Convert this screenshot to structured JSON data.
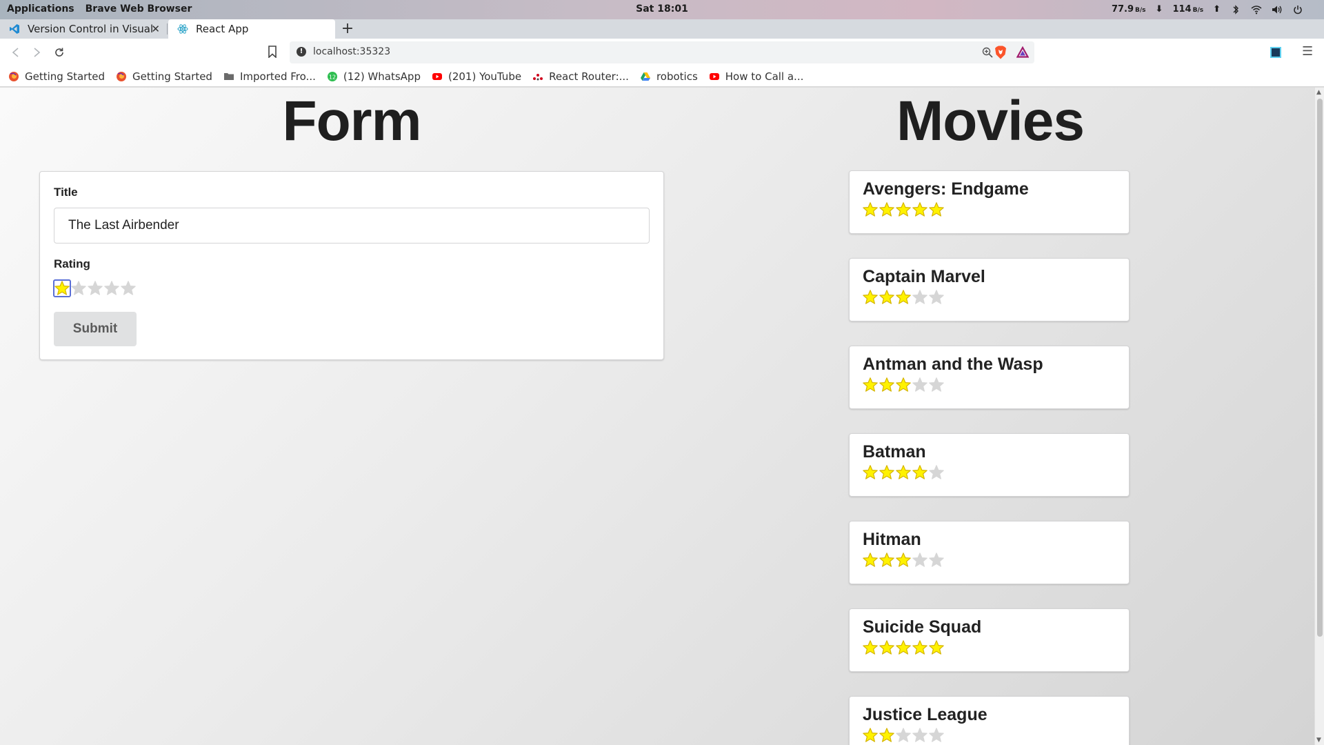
{
  "os": {
    "apps_label": "Applications",
    "active_app": "Brave Web Browser",
    "clock": "Sat 18:01",
    "net_down": "77.9",
    "net_down_unit": "B/s",
    "net_up": "114",
    "net_up_unit": "B/s"
  },
  "tabs": [
    {
      "label": "Version Control in Visual St",
      "icon": "vscode-icon",
      "active": false
    },
    {
      "label": "React App",
      "icon": "react-icon",
      "active": true
    }
  ],
  "toolbar": {
    "url": "localhost:35323"
  },
  "bookmarks": [
    {
      "label": "Getting Started",
      "icon": "firefox-icon"
    },
    {
      "label": "Getting Started",
      "icon": "firefox-icon"
    },
    {
      "label": "Imported Fro...",
      "icon": "folder-icon"
    },
    {
      "label": "(12) WhatsApp",
      "icon": "whatsapp-icon"
    },
    {
      "label": "(201) YouTube",
      "icon": "youtube-icon"
    },
    {
      "label": "React Router:...",
      "icon": "react-router-icon"
    },
    {
      "label": "robotics",
      "icon": "drive-icon"
    },
    {
      "label": "How to Call a...",
      "icon": "youtube-icon"
    }
  ],
  "form": {
    "heading": "Form",
    "title_label": "Title",
    "title_value": "The Last Airbender",
    "rating_label": "Rating",
    "rating_value": 1,
    "rating_max": 5,
    "submit_label": "Submit"
  },
  "movies": {
    "heading": "Movies",
    "items": [
      {
        "title": "Avengers: Endgame",
        "rating": 5
      },
      {
        "title": "Captain Marvel",
        "rating": 3
      },
      {
        "title": "Antman and the Wasp",
        "rating": 3
      },
      {
        "title": "Batman",
        "rating": 4
      },
      {
        "title": "Hitman",
        "rating": 3
      },
      {
        "title": "Suicide Squad",
        "rating": 5
      },
      {
        "title": "Justice League",
        "rating": 2
      }
    ]
  },
  "colors": {
    "star_on": "#fff200",
    "star_on_stroke": "#d4b400",
    "star_off": "#d6d6d6"
  }
}
